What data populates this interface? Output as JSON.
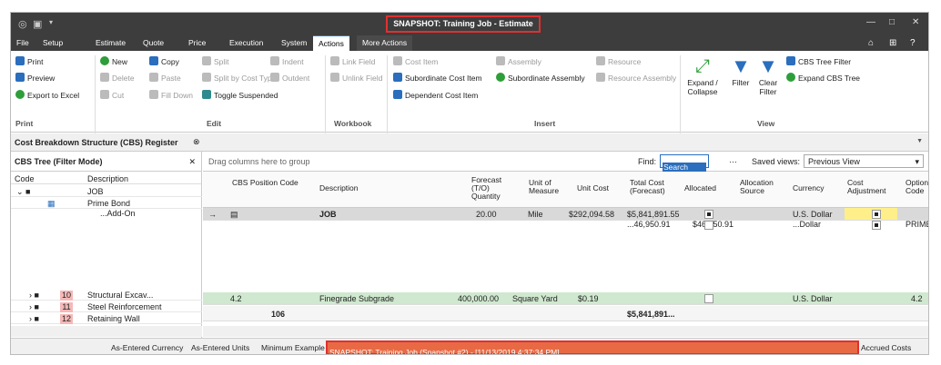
{
  "titlebar": {
    "title": "SNAPSHOT: Training Job - Estimate",
    "minimize": "—",
    "maximize": "□",
    "close": "✕"
  },
  "menu": [
    "File",
    "Setup",
    "Estimate",
    "Quote",
    "Price",
    "Execution",
    "System",
    "Actions",
    "More Actions"
  ],
  "ribbon": {
    "print": {
      "print": "Print",
      "preview": "Preview",
      "export": "Export to Excel",
      "group": "Print"
    },
    "edit": {
      "new": "New",
      "delete": "Delete",
      "cut": "Cut",
      "copy": "Copy",
      "paste": "Paste",
      "filldown": "Fill Down",
      "split": "Split",
      "splitcost": "Split by Cost Type",
      "toggle": "Toggle Suspended",
      "indent": "Indent",
      "outdent": "Outdent",
      "group": "Edit"
    },
    "workbook": {
      "link": "Link Field",
      "unlink": "Unlink Field",
      "group": "Workbook"
    },
    "insert": {
      "cost": "Cost Item",
      "subcost": "Subordinate Cost Item",
      "depcost": "Dependent Cost Item",
      "assembly": "Assembly",
      "subassembly": "Subordinate Assembly",
      "resource": "Resource",
      "resassembly": "Resource Assembly",
      "group": "Insert"
    },
    "view": {
      "expand": "Expand / Collapse",
      "filter": "Filter",
      "clear": "Clear Filter",
      "treefilter": "CBS Tree Filter",
      "expandtree": "Expand CBS Tree",
      "group": "View"
    }
  },
  "doctab": {
    "title": "Cost Breakdown Structure (CBS) Register"
  },
  "tree": {
    "title": "CBS Tree (Filter Mode)",
    "col_code": "Code",
    "col_desc": "Description",
    "rows": [
      {
        "code": "",
        "desc": "JOB"
      },
      {
        "code": "",
        "desc": "Prime Bond"
      },
      {
        "code": "",
        "desc": "...Add-On"
      }
    ],
    "bottom_rows": [
      {
        "num": "10",
        "desc": "Structural Excav..."
      },
      {
        "num": "11",
        "desc": "Steel Reinforcement"
      },
      {
        "num": "12",
        "desc": "Retaining Wall"
      }
    ]
  },
  "grid": {
    "group_hint": "Drag columns here to group",
    "find_label": "Find:",
    "find_placeholder": "Search For...",
    "saved_label": "Saved views:",
    "saved_value": "Previous View",
    "headers": [
      "CBS Position Code",
      "Description",
      "Forecast (T/O) Quantity",
      "Unit of Measure",
      "Unit Cost",
      "Total Cost (Forecast)",
      "Allocated",
      "Allocation Source",
      "Currency",
      "Cost Adjustment",
      "Optional Code"
    ],
    "row1": {
      "code": "",
      "desc": "JOB",
      "qty": "20.00",
      "uom": "Mile",
      "unit": "$292,094.58",
      "total": "$5,841,891.55",
      "currency": "U.S. Dollar"
    },
    "row2": {
      "unit": "...46,950.91",
      "total": "$46,950.91",
      "currency": "...Dollar",
      "optional": "PRIME"
    },
    "row3": {
      "code": "4.2",
      "desc": "Finegrade Subgrade",
      "qty": "400,000.00",
      "uom": "Square Yard",
      "unit": "$0.19",
      "currency": "U.S. Dollar",
      "optional": "4.2"
    },
    "footer": {
      "count": "106",
      "total": "$5,841,891..."
    }
  },
  "status": {
    "currency": "As-Entered Currency",
    "units": "As-Entered Units",
    "example": "Minimum Example",
    "snapshot": "SNAPSHOT: Training Job (Snapshot #2) - [11/13/2019 4:37:34 PM]",
    "accrued": "Accrued Costs OFF"
  }
}
